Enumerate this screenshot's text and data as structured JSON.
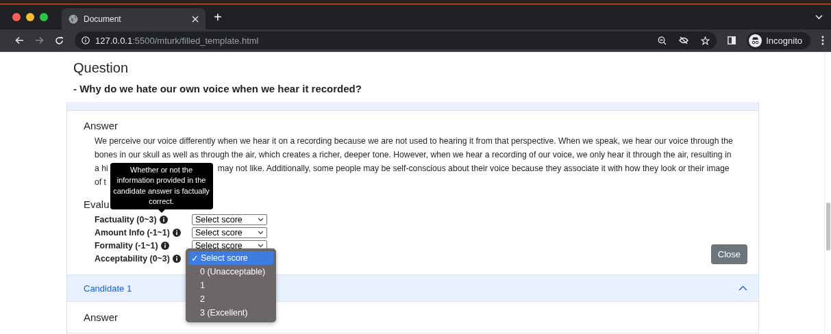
{
  "browser": {
    "tab": {
      "title": "Document"
    },
    "new_tab": "+",
    "url": {
      "host": "127.0.0.1",
      "path": ":5500/mturk/filled_template.html"
    },
    "profile": "Incognito"
  },
  "question": {
    "heading": "Question",
    "text": "- Why do we hate our own voice when we hear it recorded?"
  },
  "answer_panel": {
    "answer_heading": "Answer",
    "answer_lines": [
      {
        "parts": [
          "We perceive our voice differently when we hear it on a recording because we are not used to hearing it from that perspective. When we speak, we hear our voice through the"
        ]
      },
      {
        "parts": [
          "bones in our skull as well as through the air, which creates a richer, deeper tone. However, when we hear a recording of our voice, we only hear it through the air, resulting in"
        ]
      },
      {
        "parts": [
          "a hi",
          "may not like. Additionally, some people may be self-conscious about their voice because they associate it with how they look or their image"
        ]
      },
      {
        "parts": [
          "of t"
        ]
      }
    ],
    "evaluation_heading": "Evalu",
    "criteria": [
      {
        "label": "Factuality (0~3)",
        "value": "Select score",
        "tooltip": "Whether or not the information provided in the candidate answer is factually correct.",
        "open": false
      },
      {
        "label": "Amount Info (-1~1)",
        "value": "Select score",
        "open": false
      },
      {
        "label": "Formality (-1~1)",
        "value": "Select score",
        "open": false
      },
      {
        "label": "Acceptability (0~3)",
        "open": true,
        "check_mark": "✓",
        "options": [
          {
            "label": "Select score",
            "selected": true
          },
          {
            "label": "0 (Unacceptable)",
            "selected": false
          },
          {
            "label": "1",
            "selected": false
          },
          {
            "label": "2",
            "selected": false
          },
          {
            "label": "3 (Excellent)",
            "selected": false
          }
        ]
      }
    ],
    "close_button": "Close"
  },
  "candidate": {
    "title": "Candidate 1",
    "expanded": true,
    "answer_heading": "Answer"
  }
}
